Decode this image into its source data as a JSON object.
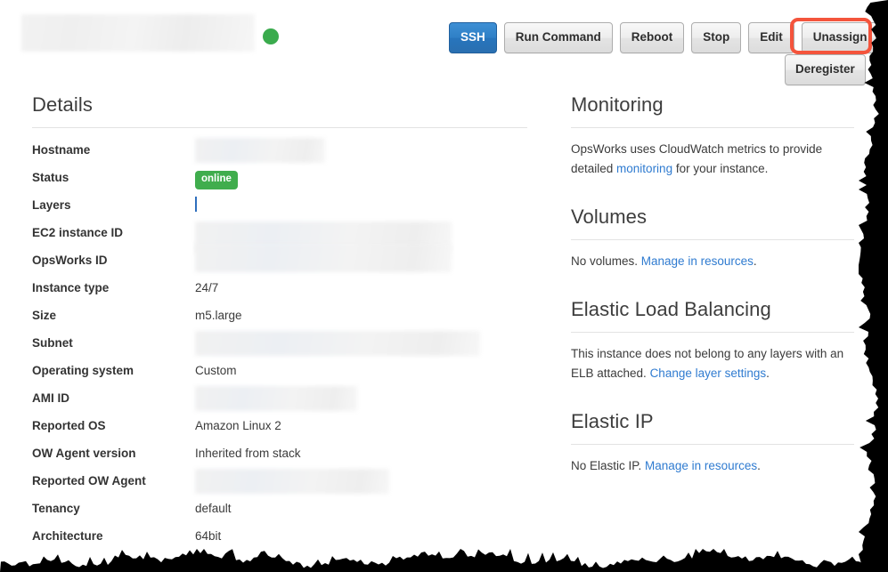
{
  "header": {
    "instance_name": "",
    "status_dot_color": "#3aab4d",
    "buttons": [
      {
        "label": "SSH",
        "style": "primary"
      },
      {
        "label": "Run Command",
        "style": "default"
      },
      {
        "label": "Reboot",
        "style": "default"
      },
      {
        "label": "Stop",
        "style": "default"
      },
      {
        "label": "Edit",
        "style": "default"
      },
      {
        "label": "Unassign",
        "style": "default",
        "highlighted": true
      }
    ],
    "deregister_label": "Deregister",
    "highlight_color": "#f4543c"
  },
  "details": {
    "title": "Details",
    "rows": [
      {
        "label": "Hostname",
        "value": "",
        "type": "redacted"
      },
      {
        "label": "Status",
        "value": "online",
        "type": "badge"
      },
      {
        "label": "Layers",
        "value": "",
        "type": "link-truncated"
      },
      {
        "label": "EC2 instance ID",
        "value": "",
        "type": "redacted-tall"
      },
      {
        "label": "OpsWorks ID",
        "value": "",
        "type": "redacted-tall-cont"
      },
      {
        "label": "Instance type",
        "value": "24/7",
        "type": "text"
      },
      {
        "label": "Size",
        "value": "m5.large",
        "type": "text"
      },
      {
        "label": "Subnet",
        "value": "",
        "type": "redacted"
      },
      {
        "label": "Operating system",
        "value": "Custom",
        "type": "text"
      },
      {
        "label": "AMI ID",
        "value": "",
        "type": "redacted"
      },
      {
        "label": "Reported OS",
        "value": "Amazon Linux 2",
        "type": "text"
      },
      {
        "label": "OW Agent version",
        "value": "Inherited from stack",
        "type": "text"
      },
      {
        "label": "Reported OW Agent",
        "value": "",
        "type": "redacted"
      },
      {
        "label": "Tenancy",
        "value": "default",
        "type": "text"
      },
      {
        "label": "Architecture",
        "value": "64bit",
        "type": "text"
      }
    ]
  },
  "monitoring": {
    "title": "Monitoring",
    "text_before": "OpsWorks uses CloudWatch metrics to provide detailed ",
    "link_label": "monitoring",
    "text_after": " for your instance."
  },
  "volumes": {
    "title": "Volumes",
    "text_before": "No volumes. ",
    "link_label": "Manage in resources",
    "text_after": "."
  },
  "elb": {
    "title": "Elastic Load Balancing",
    "text_before": "This instance does not belong to any layers with an ELB attached. ",
    "link_label": "Change layer settings",
    "text_after": "."
  },
  "elastic_ip": {
    "title": "Elastic IP",
    "text_before": "No Elastic IP. ",
    "link_label": "Manage in resources",
    "text_after": "."
  }
}
